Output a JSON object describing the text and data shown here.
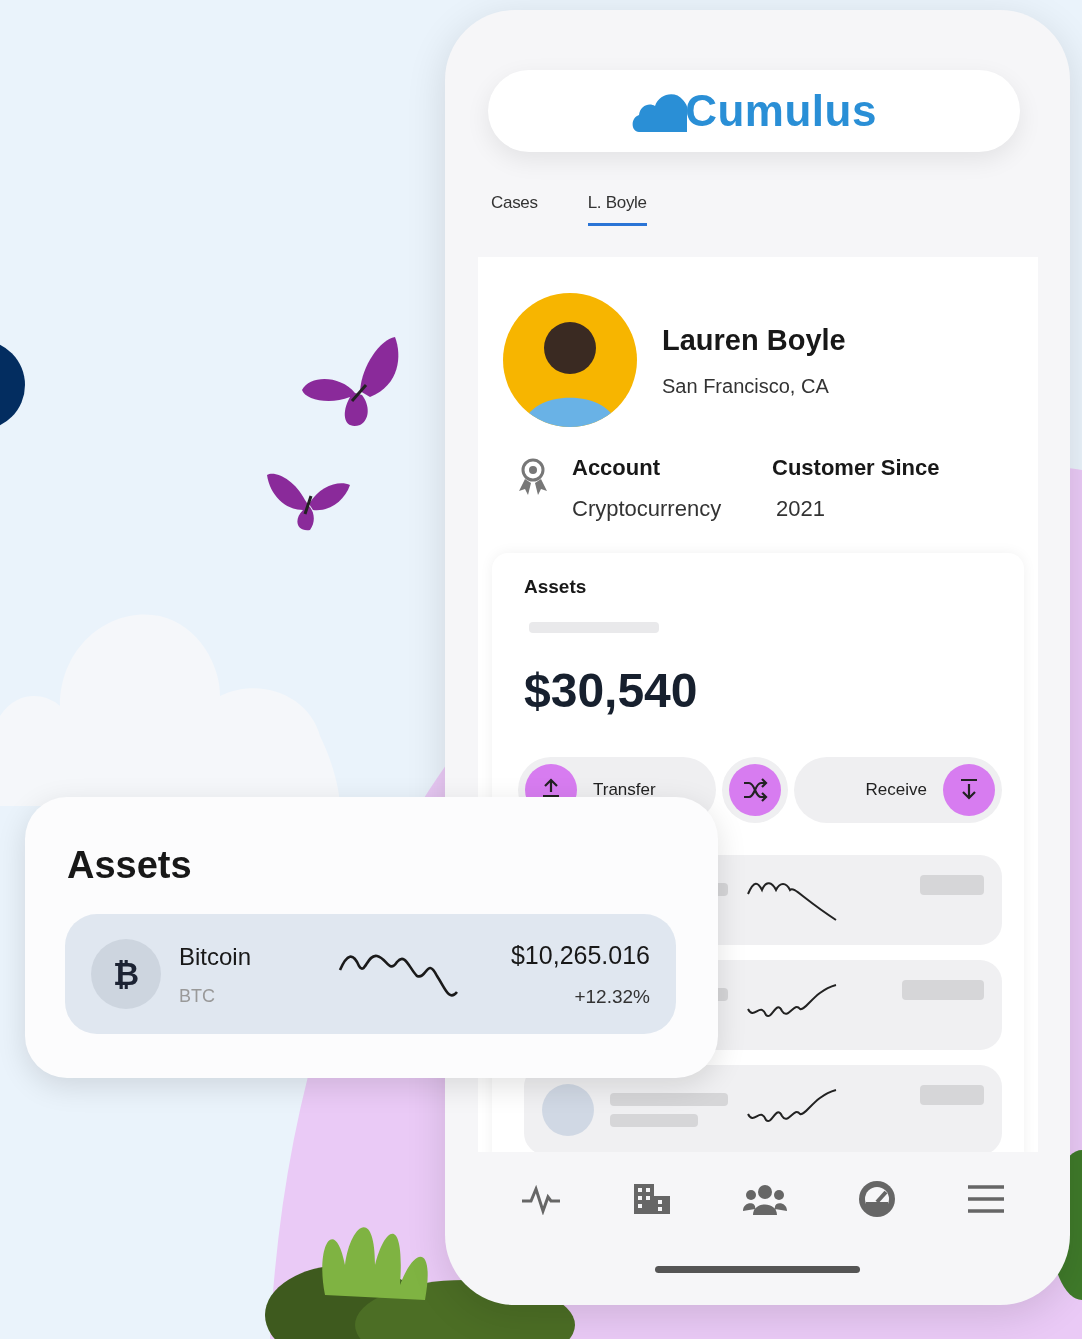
{
  "app": {
    "logo_text": "Cumulus"
  },
  "tabs": [
    {
      "label": "Cases",
      "selected": false
    },
    {
      "label": "L. Boyle",
      "selected": true
    }
  ],
  "profile": {
    "name": "Lauren Boyle",
    "location": "San Francisco, CA"
  },
  "details": [
    {
      "label": "Account",
      "value": "Cryptocurrency"
    },
    {
      "label": "Customer Since",
      "value": "2021"
    }
  ],
  "assets_card": {
    "title": "Assets",
    "amount": "$30,540"
  },
  "actions": [
    {
      "kind": "send",
      "label": "Transfer"
    },
    {
      "kind": "swap"
    },
    {
      "kind": "receive",
      "label": "Receive"
    }
  ],
  "assets_popup": {
    "title": "Assets",
    "rows": [
      {
        "icon": "₿",
        "name": "Bitcoin",
        "symbol": "BTC",
        "price": "$10,265.016",
        "change": "+12.32%"
      }
    ]
  }
}
